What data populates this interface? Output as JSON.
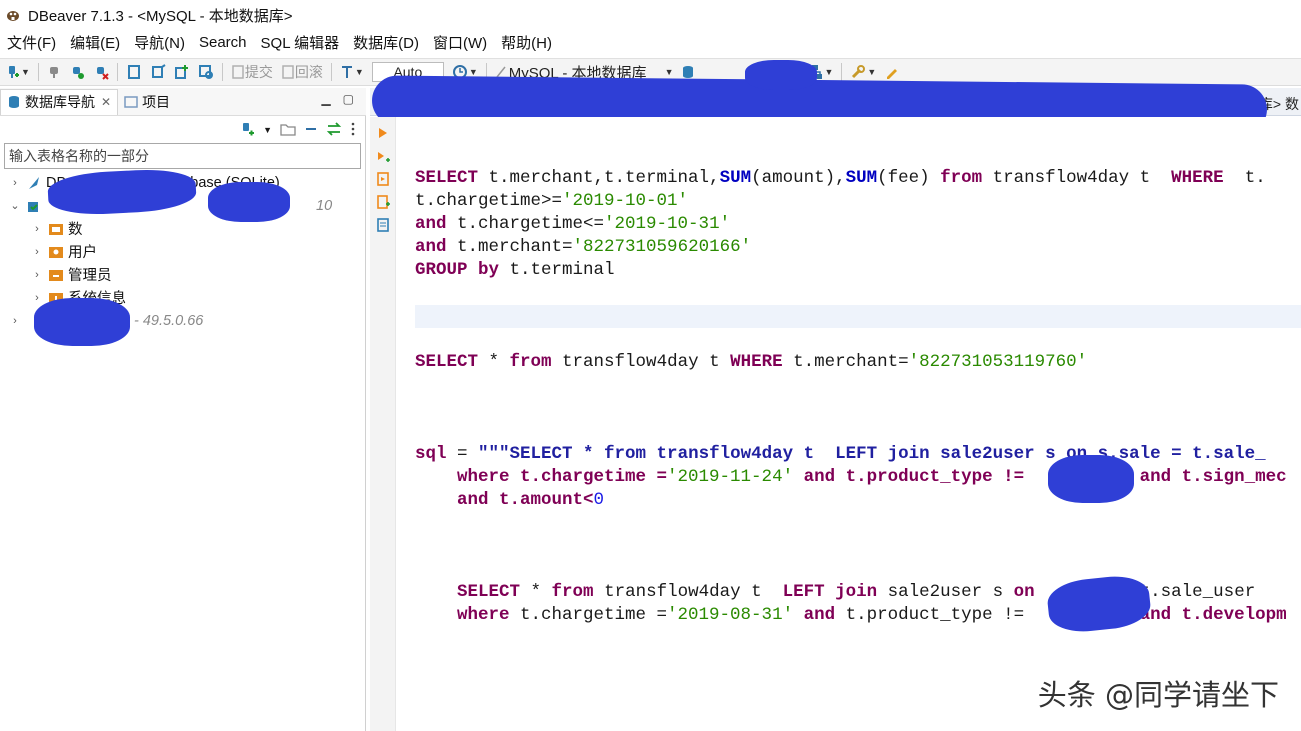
{
  "window": {
    "title": "DBeaver 7.1.3 - <MySQL - 本地数据库>"
  },
  "menu": [
    "文件(F)",
    "编辑(E)",
    "导航(N)",
    "Search",
    "SQL 编辑器",
    "数据库(D)",
    "窗口(W)",
    "帮助(H)"
  ],
  "toolbar": {
    "commit_label": "提交",
    "rollback_label": "回滚",
    "transaction_mode": "Auto",
    "active_connection": "MySQL - 本地数据库"
  },
  "left_panel": {
    "tabs": [
      {
        "label": "数据库导航",
        "active": true
      },
      {
        "label": "项目",
        "active": false
      }
    ],
    "search_placeholder": "输入表格名称的一部分",
    "tree": [
      {
        "label": "DBeaver Sample Database (SQLite)",
        "level": 0,
        "expanded": false
      },
      {
        "label": "",
        "suffix": "10",
        "level": 0,
        "expanded": true
      },
      {
        "label": "数",
        "level": 1
      },
      {
        "label": "用户",
        "level": 1
      },
      {
        "label": "管理员",
        "level": 1
      },
      {
        "label": "系统信息",
        "level": 1
      },
      {
        "label": "",
        "suffix": "- 49.5.0.66",
        "level": 0,
        "expanded": false
      }
    ]
  },
  "editor": {
    "breadcrumb": "据库> 数",
    "code": {
      "l1_a": "SELECT",
      "l1_b": " t.merchant,t.terminal,",
      "l1_c": "SUM",
      "l1_d": "(amount),",
      "l1_e": "SUM",
      "l1_f": "(fee) ",
      "l1_g": "from",
      "l1_h": " transflow4day t  ",
      "l1_i": "WHERE",
      "l1_j": "  t.",
      "l2_a": "t.chargetime>=",
      "l2_b": "'2019-10-01'",
      "l3_a": "and",
      "l3_b": " t.chargetime<=",
      "l3_c": "'2019-10-31'",
      "l4_a": "and",
      "l4_b": " t.merchant=",
      "l4_c": "'822731059620166'",
      "l5_a": "GROUP",
      "l5_b": " by",
      "l5_c": " t.terminal",
      "l6_a": "SELECT",
      "l6_b": " * ",
      "l6_c": "from",
      "l6_d": " transflow4day t ",
      "l6_e": "WHERE",
      "l6_f": " t.merchant=",
      "l6_g": "'822731053119760'",
      "l7_a": "sql",
      "l7_b": " = ",
      "l7_c": "\"\"\"SELECT * from transflow4day t  LEFT join sale2user s on s.sale = t.sale_",
      "l8_a": "    where t.chargetime =",
      "l8_b": "'2019-11-24'",
      "l8_c": " and t.product_type !=",
      "l8_d": "           and t.sign_mec",
      "l9_a": "    and t.amount<",
      "l9_b": "0",
      "l10_a": "    SELECT",
      "l10_b": " * ",
      "l10_c": "from",
      "l10_d": " transflow4day t  ",
      "l10_e": "LEFT join",
      "l10_f": " sale2user s ",
      "l10_g": "on",
      "l10_h": "        = t.sale_user",
      "l11_a": "    where",
      "l11_b": " t.chargetime =",
      "l11_c": "'2019-08-31'",
      "l11_d": " and",
      "l11_e": " t.product_type !=",
      "l11_f": "           and t.developm"
    }
  },
  "watermark": "头条 @同学请坐下",
  "colors": {
    "keyword": "#7f0055",
    "string": "#2a8a00",
    "function": "#0000c0",
    "redaction": "#2f3fd6"
  }
}
